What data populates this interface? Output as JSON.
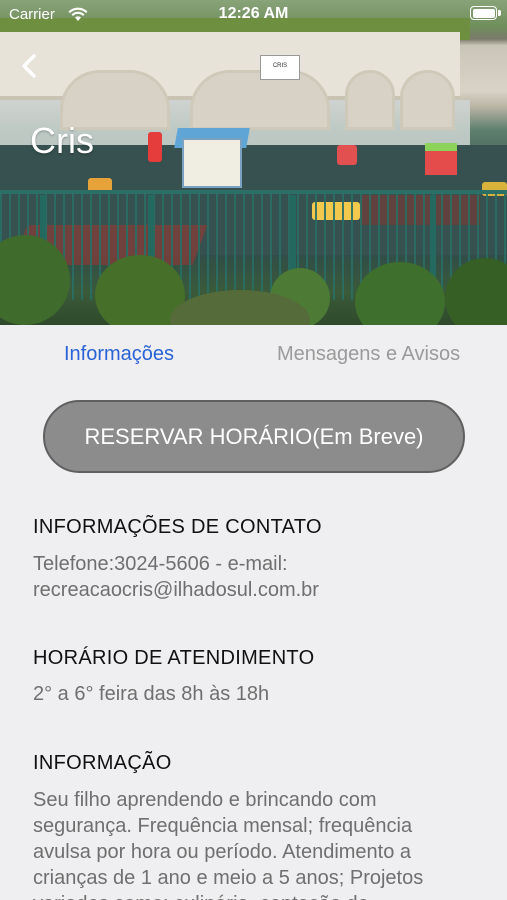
{
  "status_bar": {
    "carrier": "Carrier",
    "time": "12:26 AM"
  },
  "header": {
    "title": "Cris",
    "back_icon": "chevron-left-icon"
  },
  "tabs": [
    {
      "label": "Informações",
      "active": true
    },
    {
      "label": "Mensagens e Avisos",
      "active": false
    }
  ],
  "reserve_button": {
    "label": "RESERVAR HORÁRIO(Em Breve)"
  },
  "sections": {
    "contact": {
      "title": "INFORMAÇÕES DE CONTATO",
      "line1": "Telefone:3024-5606 - e-mail:",
      "line2": "recreacaocris@ilhadosul.com.br"
    },
    "hours": {
      "title": "HORÁRIO DE ATENDIMENTO",
      "text": "2° a 6° feira das 8h às 18h"
    },
    "info": {
      "title": "INFORMAÇÃO",
      "line1": "Seu filho aprendendo e brincando com",
      "line2": "segurança. Frequência mensal; frequência",
      "line3": "avulsa por hora ou período. Atendimento a",
      "line4": "crianças de 1 ano e meio a 5 anos; Projetos",
      "line5": "variados como: culinária, contação de"
    }
  },
  "colors": {
    "accent": "#2a63d6",
    "inactive_tab": "#9a9a9a",
    "button_bg": "#8c8c8c",
    "background": "#efeff1"
  }
}
